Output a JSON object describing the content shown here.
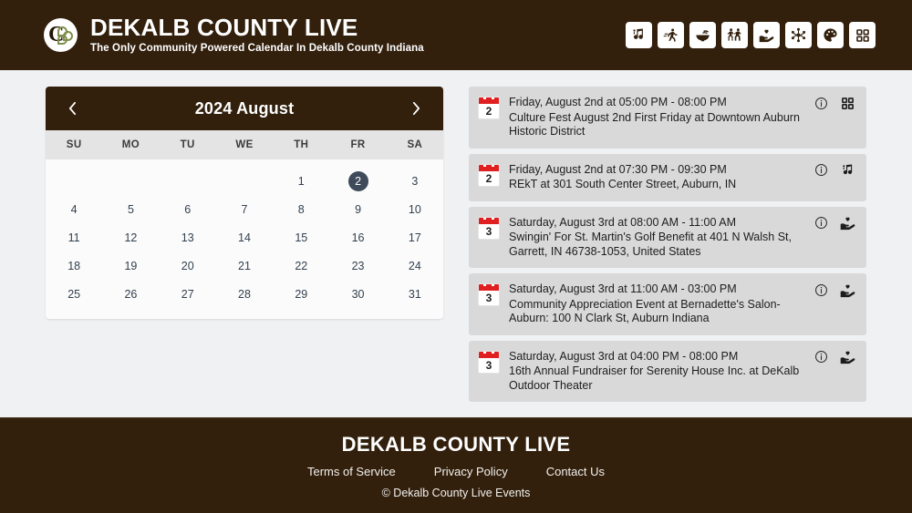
{
  "header": {
    "brand_title": "DEKALB COUNTY LIVE",
    "brand_subtitle": "The Only Community Powered Calendar In Dekalb County Indiana",
    "logo_letter": "C",
    "categories": [
      {
        "icon": "music-note-icon",
        "label": "Music"
      },
      {
        "icon": "sports-running-icon",
        "label": "Sports"
      },
      {
        "icon": "food-bowl-icon",
        "label": "Food"
      },
      {
        "icon": "family-people-icon",
        "label": "Family"
      },
      {
        "icon": "hand-heart-charity-icon",
        "label": "Charity"
      },
      {
        "icon": "network-share-icon",
        "label": "Community"
      },
      {
        "icon": "art-palette-icon",
        "label": "Arts"
      },
      {
        "icon": "grid-squares-icon",
        "label": "All Categories"
      }
    ]
  },
  "calendar": {
    "title": "2024 August",
    "prev_label": "‹",
    "next_label": "›",
    "weekdays": [
      "SU",
      "MO",
      "TU",
      "WE",
      "TH",
      "FR",
      "SA"
    ],
    "leading_blanks": 4,
    "days": [
      1,
      2,
      3,
      4,
      5,
      6,
      7,
      8,
      9,
      10,
      11,
      12,
      13,
      14,
      15,
      16,
      17,
      18,
      19,
      20,
      21,
      22,
      23,
      24,
      25,
      26,
      27,
      28,
      29,
      30,
      31
    ],
    "selected_day": 2,
    "selected_color": "#3f4a5a"
  },
  "events": [
    {
      "day": "2",
      "when": "Friday, August 2nd at 05:00 PM - 08:00 PM",
      "what": "Culture Fest August 2nd First Friday at Downtown Auburn Historic District",
      "category_icon": "grid-squares-icon"
    },
    {
      "day": "2",
      "when": "Friday, August 2nd at 07:30 PM - 09:30 PM",
      "what": "REkT at 301 South Center Street, Auburn, IN",
      "category_icon": "music-note-icon"
    },
    {
      "day": "3",
      "when": "Saturday, August 3rd at 08:00 AM - 11:00 AM",
      "what": "Swingin' For St. Martin's Golf Benefit at 401 N Walsh St, Garrett, IN 46738-1053, United States",
      "category_icon": "hand-heart-charity-icon"
    },
    {
      "day": "3",
      "when": "Saturday, August 3rd at 11:00 AM - 03:00 PM",
      "what": "Community Appreciation Event at Bernadette's Salon-Auburn: 100 N Clark St, Auburn Indiana",
      "category_icon": "hand-heart-charity-icon"
    },
    {
      "day": "3",
      "when": "Saturday, August 3rd at 04:00 PM - 08:00 PM",
      "what": "16th Annual Fundraiser for Serenity House Inc. at DeKalb Outdoor Theater",
      "category_icon": "hand-heart-charity-icon"
    }
  ],
  "pager": {
    "up_icon": "chevron-up-icon",
    "down_icon": "chevron-down-icon",
    "up_disabled": true
  },
  "footer": {
    "title": "DEKALB COUNTY LIVE",
    "links": [
      "Terms of Service",
      "Privacy Policy",
      "Contact Us"
    ],
    "copyright": "© Dekalb County Live Events"
  },
  "theme": {
    "brand_brown": "#32200d",
    "page_bg": "#f0f1f3",
    "event_row_bg": "#d9d9d9",
    "calendar_bg": "#fbfbfb",
    "weekday_bg": "#e4e4e4",
    "accent_red": "#e02020"
  }
}
